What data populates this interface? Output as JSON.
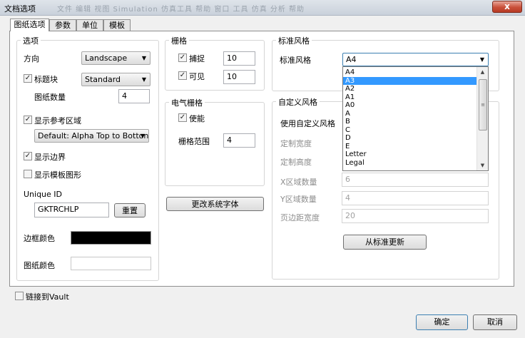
{
  "window": {
    "title": "文档选项",
    "ghost_menu": "文件 编辑 视图 Simulation 仿真工具 帮助 窗口 工具 仿真 分析 帮助",
    "close_label": "x"
  },
  "tabs": [
    {
      "label": "图纸选项",
      "active": true
    },
    {
      "label": "参数",
      "active": false
    },
    {
      "label": "单位",
      "active": false
    },
    {
      "label": "模板",
      "active": false
    }
  ],
  "options": {
    "legend": "选项",
    "orientation_label": "方向",
    "orientation_value": "Landscape",
    "title_block_label": "标题块",
    "title_block_checked": true,
    "title_block_value": "Standard",
    "sheet_count_label": "图纸数量",
    "sheet_count_value": "4",
    "show_reference_label": "显示参考区域",
    "show_reference_checked": true,
    "reference_value": "Default: Alpha Top to Botton",
    "show_border_label": "显示边界",
    "show_border_checked": true,
    "show_template_label": "显示模板图形",
    "show_template_checked": false,
    "unique_id_label": "Unique ID",
    "unique_id_value": "GKTRCHLP",
    "reset_label": "重置",
    "border_color_label": "边框颜色",
    "border_color": "#000000",
    "sheet_color_label": "图纸颜色",
    "sheet_color": "#ffffff"
  },
  "grid": {
    "legend": "栅格",
    "snap_label": "捕捉",
    "snap_checked": true,
    "snap_value": "10",
    "visible_label": "可见",
    "visible_checked": true,
    "visible_value": "10"
  },
  "electrical_grid": {
    "legend": "电气栅格",
    "enable_label": "使能",
    "enable_checked": true,
    "range_label": "栅格范围",
    "range_value": "4"
  },
  "change_font_label": "更改系统字体",
  "standard_style": {
    "legend": "标准风格",
    "label": "标准风格",
    "value": "A4",
    "options": [
      "A4",
      "A3",
      "A2",
      "A1",
      "A0",
      "A",
      "B",
      "C",
      "D",
      "E",
      "Letter",
      "Legal"
    ],
    "highlighted_index": 1
  },
  "custom_style": {
    "legend": "自定义风格",
    "use_custom_label": "使用自定义风格",
    "custom_width_label": "定制宽度",
    "custom_height_label": "定制高度",
    "x_zones_label": "X区域数量",
    "x_zones_value": "6",
    "y_zones_label": "Y区域数量",
    "y_zones_value": "4",
    "margin_label": "页边距宽度",
    "margin_value": "20",
    "update_from_standard_label": "从标准更新"
  },
  "link_vault_label": "链接到Vault",
  "link_vault_checked": false,
  "ok_label": "确定",
  "cancel_label": "取消",
  "check_glyph": "✓",
  "colors": {
    "selection": "#3399ff",
    "close_button": "#c9503a"
  }
}
